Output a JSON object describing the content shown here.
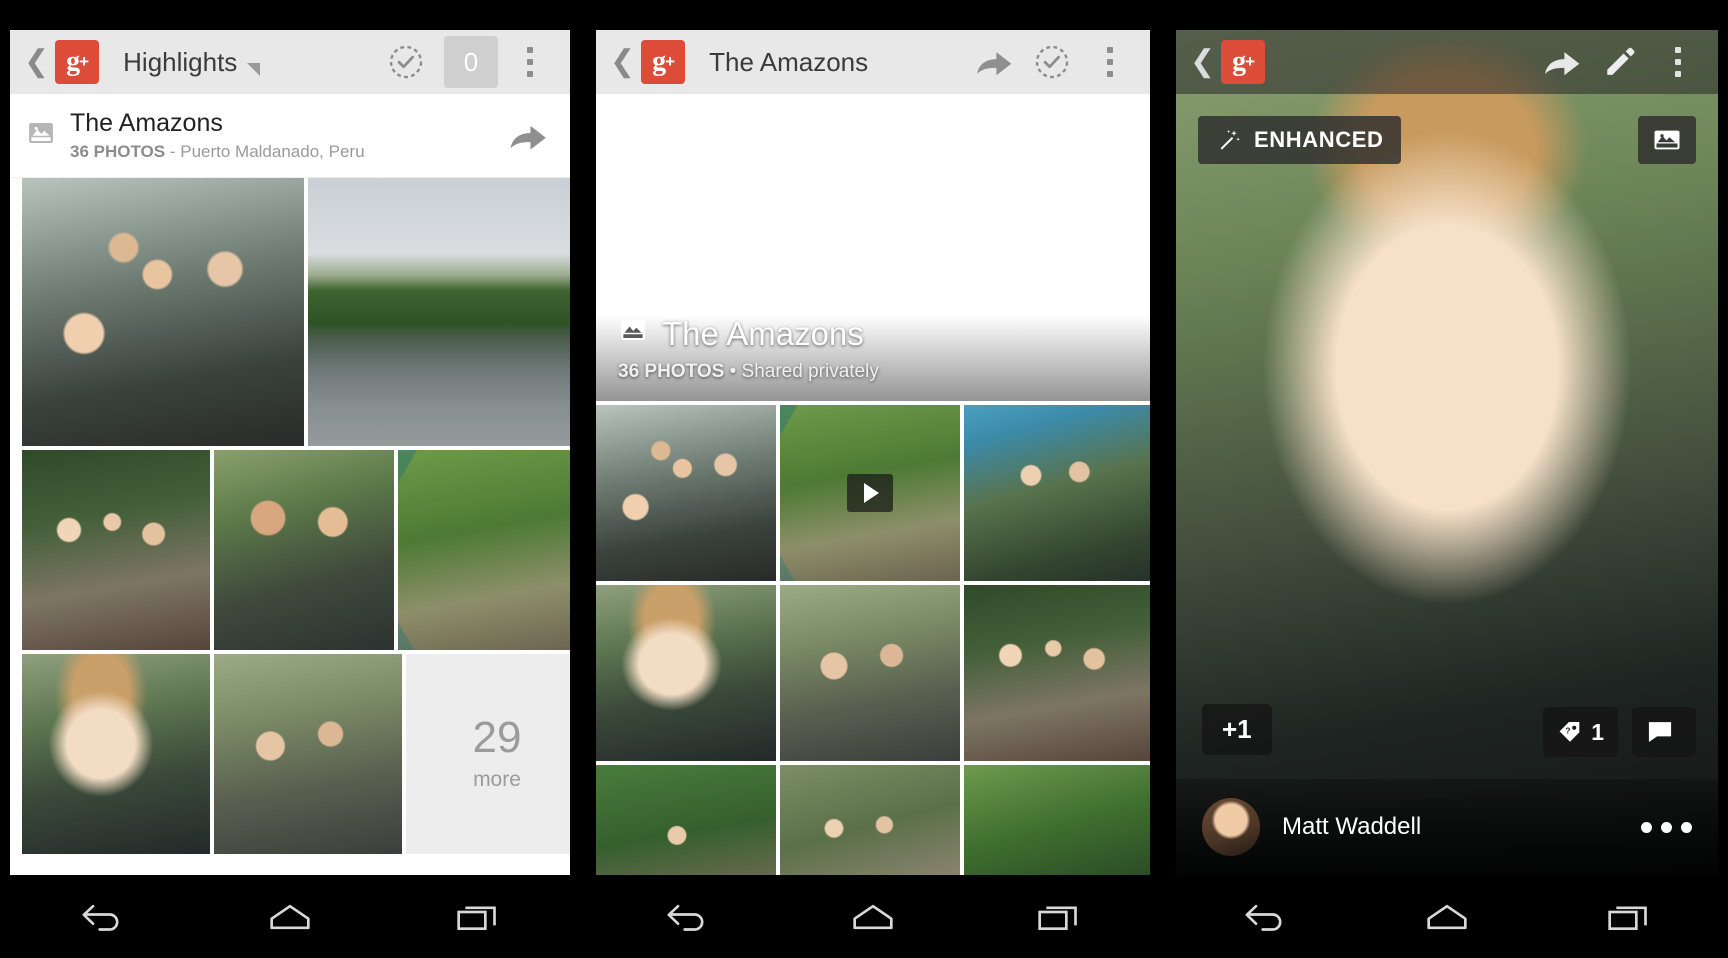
{
  "screen1": {
    "actionbar": {
      "back_icon": "chevron-left-icon",
      "logo": "google-plus-logo",
      "logo_text": "g",
      "logo_sup": "+",
      "title": "Highlights",
      "dropdown_icon": "caret-down-icon",
      "select_icon": "check-circle-dashed-icon",
      "count": "0",
      "overflow_icon": "kebab-menu-icon"
    },
    "album_strip": {
      "icon": "photo-album-icon",
      "title": "The Amazons",
      "photos_count": "36 PHOTOS",
      "separator": " - ",
      "location": "Puerto Maldanado, Peru",
      "share_icon": "share-arrow-icon"
    },
    "grid": {
      "more_count": "29",
      "more_label": "more",
      "tiles": [
        {
          "name": "photo-group-selfie",
          "class": "img-group1"
        },
        {
          "name": "photo-river-reflection",
          "class": "img-river"
        },
        {
          "name": "photo-group-on-stairs",
          "class": "img-groupstairs"
        },
        {
          "name": "photo-two-men-boat",
          "class": "img-twomen"
        },
        {
          "name": "photo-bridge-stretch",
          "class": "img-bridge"
        },
        {
          "name": "photo-woman-portrait",
          "class": "img-woman"
        },
        {
          "name": "photo-two-guys-cap",
          "class": "img-twoguys"
        }
      ]
    }
  },
  "screen2": {
    "actionbar": {
      "back_icon": "chevron-left-icon",
      "logo_text": "g",
      "logo_sup": "+",
      "title": "The Amazons",
      "share_icon": "share-arrow-icon",
      "select_icon": "check-circle-dashed-icon",
      "overflow_icon": "kebab-menu-icon"
    },
    "hero": {
      "icon": "photo-album-icon",
      "title": "The Amazons",
      "photos_count": "36 PHOTOS",
      "separator": " • ",
      "privacy": "Shared privately"
    },
    "grid_tiles": [
      {
        "name": "photo-group-selfie",
        "class": "img-group1"
      },
      {
        "name": "photo-bridge-video",
        "class": "img-bridge",
        "video": true
      },
      {
        "name": "photo-raft-two-men",
        "class": "img-raft"
      },
      {
        "name": "photo-woman-portrait",
        "class": "img-woman"
      },
      {
        "name": "photo-two-guys-cap",
        "class": "img-twoguys"
      },
      {
        "name": "photo-group-poles",
        "class": "img-people-boat"
      },
      {
        "name": "photo-man-canoe",
        "class": "img-canoe"
      },
      {
        "name": "photo-walkers-trail",
        "class": "img-walkers"
      },
      {
        "name": "photo-jungle-canopy",
        "class": "img-jungle"
      }
    ]
  },
  "screen3": {
    "actionbar": {
      "back_icon": "chevron-left-icon",
      "logo_text": "g",
      "logo_sup": "+",
      "share_icon": "share-arrow-icon",
      "edit_icon": "pencil-icon",
      "overflow_icon": "kebab-menu-icon"
    },
    "enhanced_chip": {
      "icon": "magic-wand-icon",
      "label": "ENHANCED"
    },
    "filmstrip_button": {
      "icon": "filmstrip-icon"
    },
    "plus_one": {
      "label": "+1"
    },
    "badges": [
      {
        "name": "tag-badge",
        "icon": "tag-question-icon",
        "count": "1"
      },
      {
        "name": "comment-badge",
        "icon": "comment-bubble-icon",
        "count": ""
      }
    ],
    "author": {
      "avatar": "user-avatar",
      "name": "Matt Waddell",
      "overflow_icon": "three-dots-icon"
    }
  },
  "navbar": {
    "back": "back-nav-icon",
    "home": "home-nav-icon",
    "recents": "recents-nav-icon"
  },
  "colors": {
    "brand_red": "#dd4b39",
    "actionbar_light": "#e8e8e8",
    "more_panel": "#ededed",
    "nav_bg": "#000000"
  }
}
